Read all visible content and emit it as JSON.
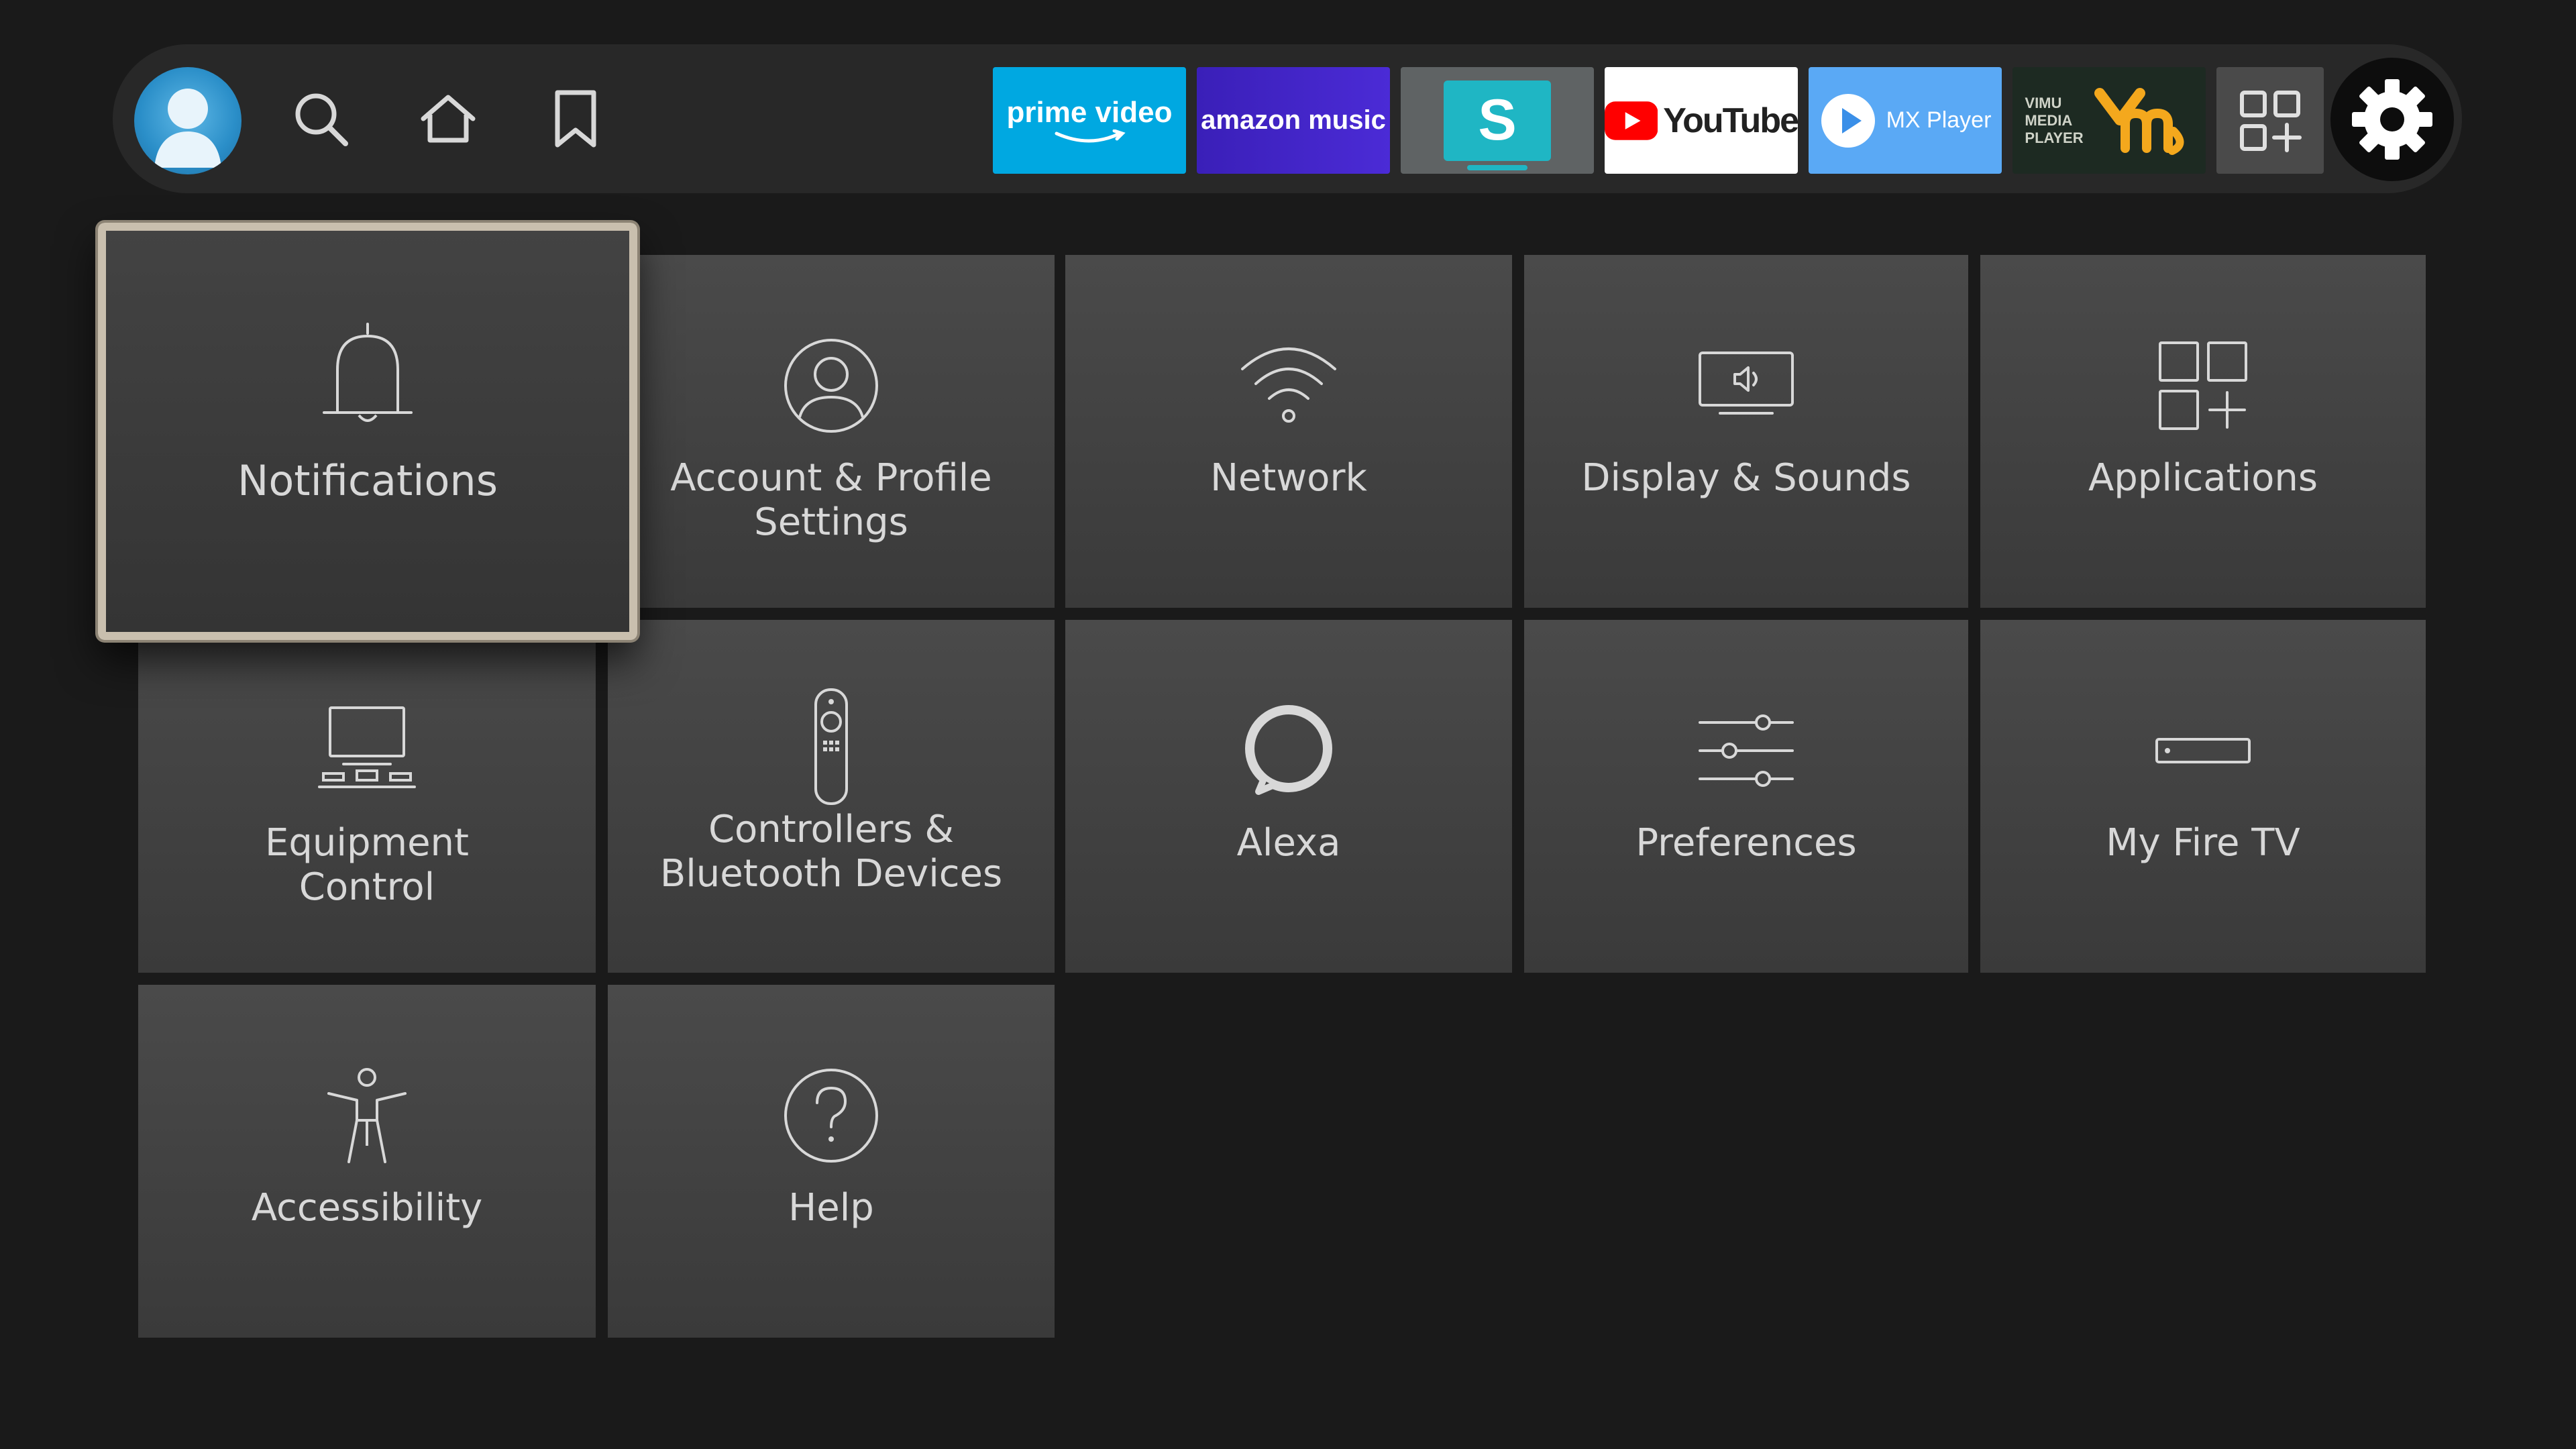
{
  "topbar": {
    "apps": {
      "prime": {
        "line1": "prime video"
      },
      "music": {
        "line1": "amazon music"
      },
      "sling": {
        "letter": "S"
      },
      "youtube": {
        "name": "YouTube"
      },
      "mx": {
        "name": "MX Player"
      },
      "vimu": {
        "line1": "VIMU",
        "line2": "MEDIA",
        "line3": "PLAYER"
      }
    }
  },
  "tiles": [
    {
      "label": "Notifications",
      "icon": "bell-icon"
    },
    {
      "label": "Account & Profile Settings",
      "icon": "person-icon"
    },
    {
      "label": "Network",
      "icon": "wifi-icon"
    },
    {
      "label": "Display & Sounds",
      "icon": "display-icon"
    },
    {
      "label": "Applications",
      "icon": "apps-icon"
    },
    {
      "label": "Equipment Control",
      "icon": "equipment-icon"
    },
    {
      "label": "Controllers & Bluetooth Devices",
      "icon": "remote-icon"
    },
    {
      "label": "Alexa",
      "icon": "alexa-icon"
    },
    {
      "label": "Preferences",
      "icon": "sliders-icon"
    },
    {
      "label": "My Fire TV",
      "icon": "firetv-icon"
    },
    {
      "label": "Accessibility",
      "icon": "accessibility-icon"
    },
    {
      "label": "Help",
      "icon": "help-icon"
    }
  ],
  "colors": {
    "background": "#1a1a1a",
    "topbar": "#282828",
    "tile": "#424242",
    "focus_border": "#c9bfae",
    "text": "#d8d8d8"
  }
}
